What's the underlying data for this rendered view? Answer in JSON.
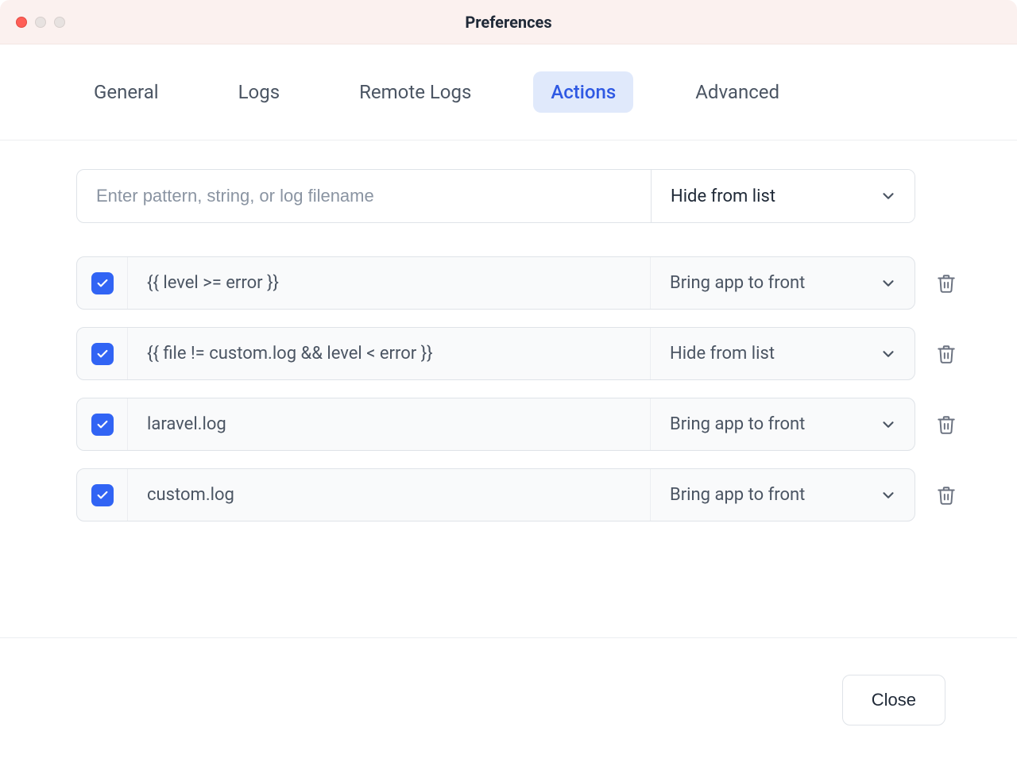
{
  "window": {
    "title": "Preferences"
  },
  "tabs": {
    "items": [
      "General",
      "Logs",
      "Remote Logs",
      "Actions",
      "Advanced"
    ],
    "active_index": 3
  },
  "new_rule": {
    "pattern_placeholder": "Enter pattern, string, or log filename",
    "pattern_value": "",
    "action": "Hide from list"
  },
  "rules": [
    {
      "enabled": true,
      "pattern": "{{ level >= error }}",
      "action": "Bring app to front"
    },
    {
      "enabled": true,
      "pattern": "{{ file != custom.log && level < error }}",
      "action": "Hide from list"
    },
    {
      "enabled": true,
      "pattern": "laravel.log",
      "action": "Bring app to front"
    },
    {
      "enabled": true,
      "pattern": "custom.log",
      "action": "Bring app to front"
    }
  ],
  "footer": {
    "close_label": "Close"
  }
}
